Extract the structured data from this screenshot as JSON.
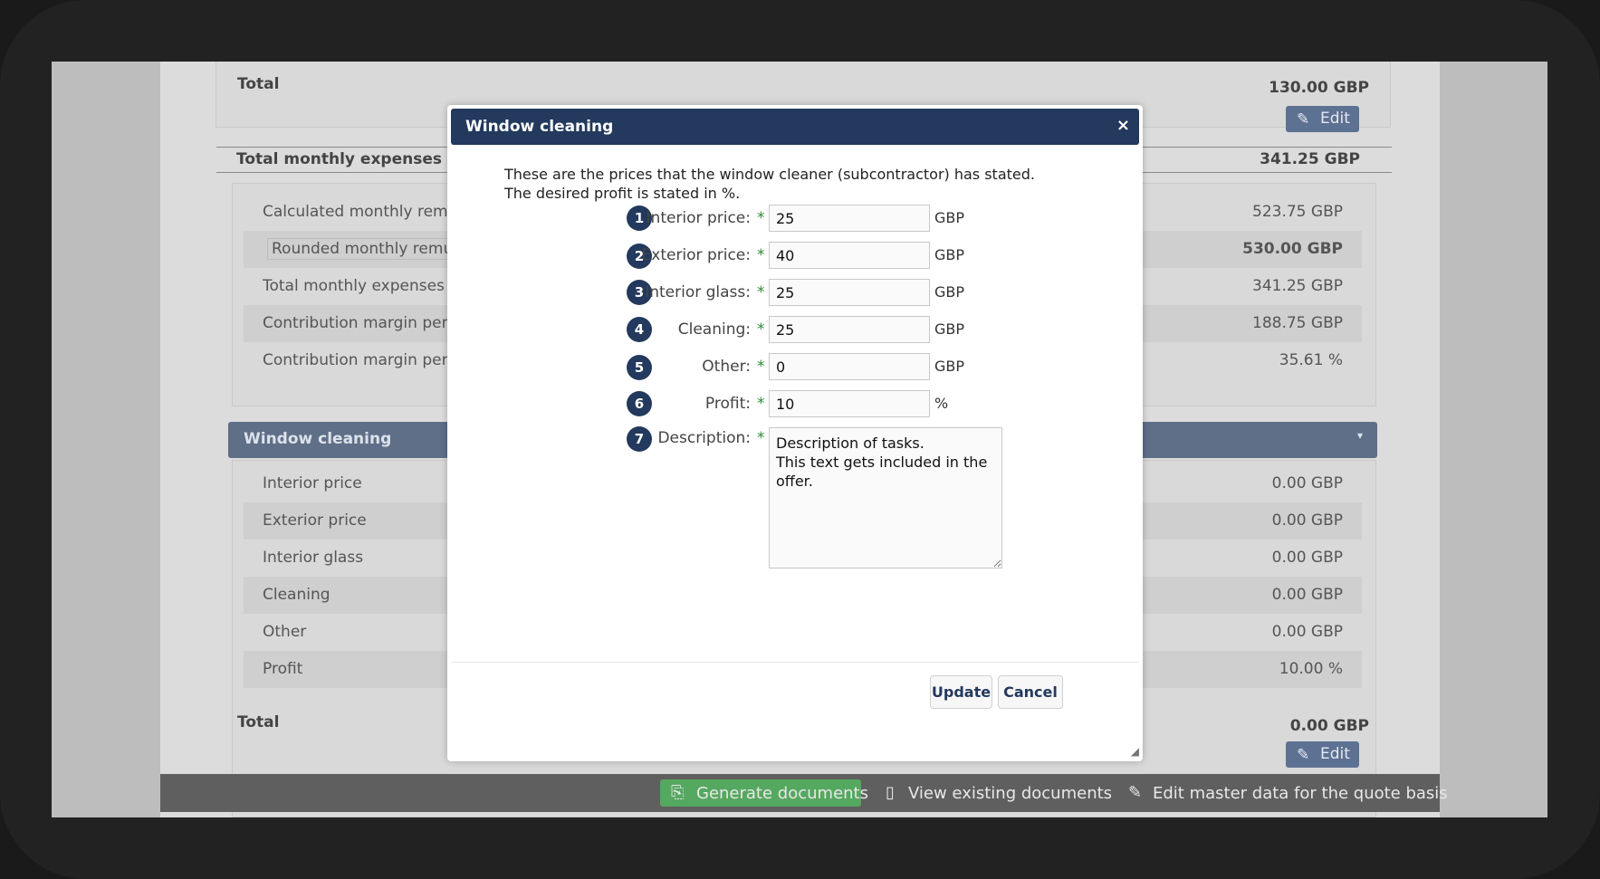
{
  "background": {
    "total_top": {
      "label": "Total",
      "value": "130.00 GBP",
      "edit": "Edit"
    },
    "total_monthly_expenses": {
      "label": "Total monthly expenses",
      "value": "341.25 GBP"
    },
    "summary_rows": [
      {
        "label": "Calculated monthly remune",
        "value": "523.75 GBP"
      },
      {
        "label": "Rounded monthly remune",
        "value": "530.00 GBP"
      },
      {
        "label": "Total monthly expenses",
        "value": "341.25 GBP"
      },
      {
        "label": "Contribution margin per m",
        "value": "188.75 GBP"
      },
      {
        "label": "Contribution margin per m",
        "value": "35.61 %"
      }
    ],
    "section_title": "Window cleaning",
    "section_rows": [
      {
        "label": "Interior price",
        "value": "0.00 GBP"
      },
      {
        "label": "Exterior price",
        "value": "0.00 GBP"
      },
      {
        "label": "Interior glass",
        "value": "0.00 GBP"
      },
      {
        "label": "Cleaning",
        "value": "0.00 GBP"
      },
      {
        "label": "Other",
        "value": "0.00 GBP"
      },
      {
        "label": "Profit",
        "value": "10.00 %"
      }
    ],
    "total_bottom": {
      "label": "Total",
      "value": "0.00 GBP",
      "edit": "Edit"
    }
  },
  "toolbar": {
    "generate": "Generate documents",
    "view": "View existing documents",
    "master": "Edit master data for the quote basis"
  },
  "modal": {
    "title": "Window cleaning",
    "close": "×",
    "intro": "These are the prices that the window cleaner (subcontractor) has stated. The desired profit is stated in %.",
    "fields": [
      {
        "num": "1",
        "label": "Interior price:",
        "value": "25",
        "unit": "GBP"
      },
      {
        "num": "2",
        "label": "Exterior price:",
        "value": "40",
        "unit": "GBP"
      },
      {
        "num": "3",
        "label": "Interior glass:",
        "value": "25",
        "unit": "GBP"
      },
      {
        "num": "4",
        "label": "Cleaning:",
        "value": "25",
        "unit": "GBP"
      },
      {
        "num": "5",
        "label": "Other:",
        "value": "0",
        "unit": "GBP"
      },
      {
        "num": "6",
        "label": "Profit:",
        "value": "10",
        "unit": "%"
      }
    ],
    "description": {
      "num": "7",
      "label": "Description:",
      "value": "Description of tasks.\nThis text gets included in the offer."
    },
    "required_mark": "*",
    "update": "Update",
    "cancel": "Cancel"
  }
}
